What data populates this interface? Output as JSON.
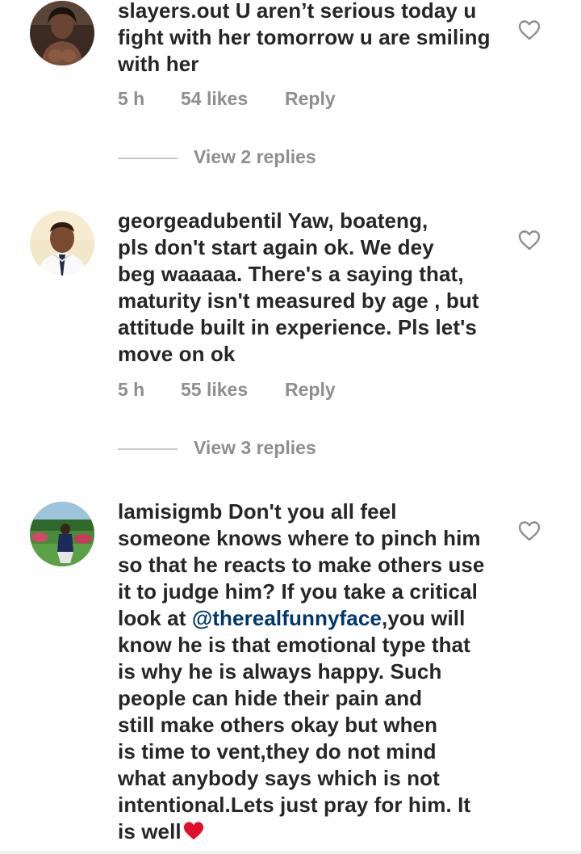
{
  "comments": [
    {
      "username": "slayers.out",
      "lines": [
        "U aren’t serious today u",
        "fight with her tomorrow u are smiling",
        "with her"
      ],
      "time": "5 h",
      "likes": "54 likes",
      "reply": "Reply",
      "view_replies": "View 2 replies"
    },
    {
      "username": "georgeadubentil",
      "lines": [
        "Yaw, boateng,",
        "pls don't start again ok. We dey",
        "beg waaaaa. There's a saying that,",
        "maturity isn't measured by age , but",
        "attitude built in experience. Pls let's",
        "move on ok"
      ],
      "time": "5 h",
      "likes": "55 likes",
      "reply": "Reply",
      "view_replies": "View 3 replies"
    },
    {
      "username": "lamisigmb",
      "lines": [
        "Don't you all feel",
        "someone knows where to pinch him",
        "so that he reacts to make others use",
        "it to judge him? If you take a critical",
        "look at ",
        "know he is that emotional type that",
        "is why he is always happy. Such",
        "people can hide their pain and",
        "still make others okay but when",
        "is time to vent,they do not mind",
        "what anybody says which is not",
        "intentional.Lets just pray for him. It",
        "is well"
      ],
      "mention": "@therealfunnyface",
      "after_mention": ",you will",
      "emoji": "❤️"
    }
  ],
  "colors": {
    "text": "#262626",
    "secondary": "#8e8e8e",
    "mention": "#00376b",
    "divider": "#c7c7c7",
    "heart_emoji": "#e0102b"
  },
  "icons": {
    "like": "heart-outline-icon",
    "emoji": "red-heart-emoji"
  }
}
